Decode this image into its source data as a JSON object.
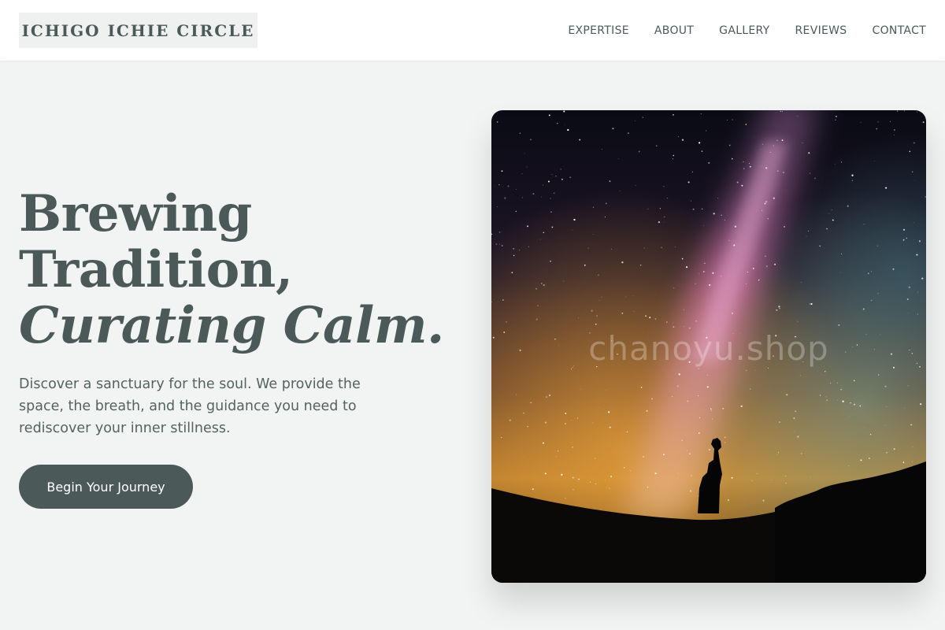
{
  "brand": {
    "name": "ICHIGO ICHIE CIRCLE"
  },
  "nav": {
    "items": [
      {
        "label": "EXPERTISE"
      },
      {
        "label": "ABOUT"
      },
      {
        "label": "GALLERY"
      },
      {
        "label": "REVIEWS"
      },
      {
        "label": "CONTACT"
      }
    ]
  },
  "hero": {
    "title_line1": "Brewing",
    "title_line2": "Tradition,",
    "title_line3": "Curating Calm.",
    "description": "Discover a sanctuary for the soul. We provide the space, the breath, and the guidance you need to rediscover your inner stillness.",
    "cta_label": "Begin Your Journey",
    "image_watermark": "chanoyu.shop"
  },
  "colors": {
    "primary": "#4b5a59",
    "background": "#f2f4f3",
    "header_bg": "#ffffff",
    "logo_bg": "#eff1f0"
  }
}
